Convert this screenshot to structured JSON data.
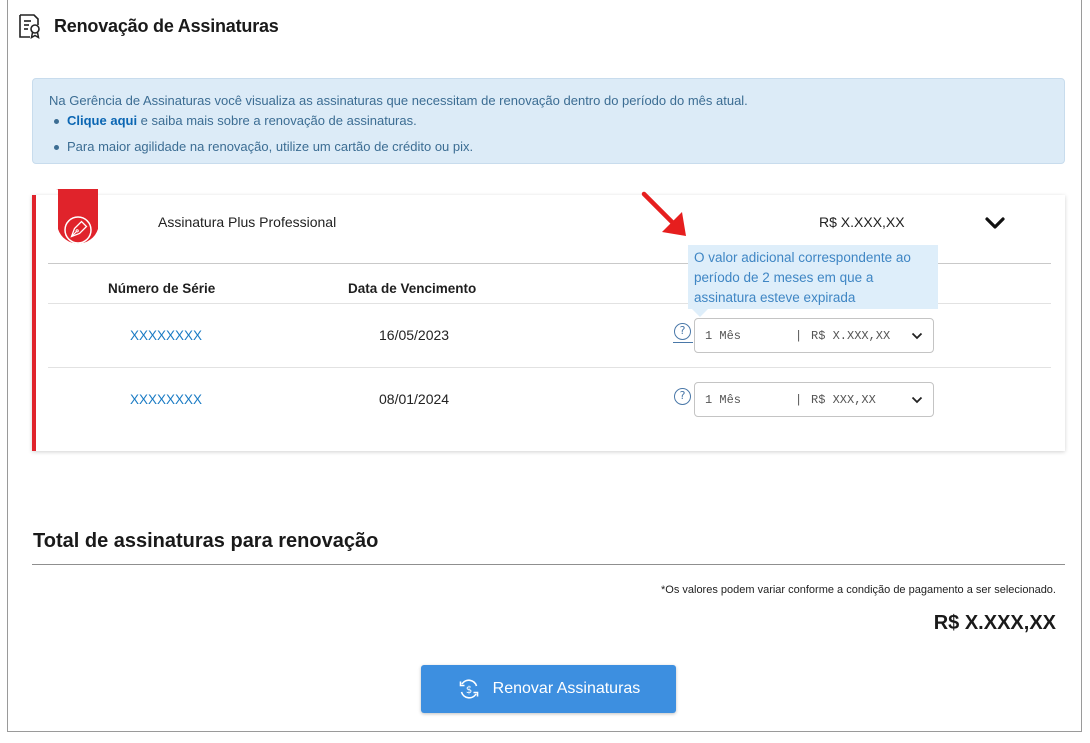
{
  "header": {
    "title": "Renovação de Assinaturas",
    "icon": "certificate-document-icon"
  },
  "info": {
    "intro": "Na Gerência de Assinaturas você visualiza as assinaturas que necessitam de renovação dentro do período do mês atual.",
    "bullets": [
      {
        "link": "Clique aqui",
        "text": " e saiba mais sobre a renovação de assinaturas."
      },
      {
        "text": "Para maior agilidade na renovação, utilize um cartão de crédito ou pix."
      }
    ]
  },
  "subscription": {
    "name": "Assinatura Plus Professional",
    "price": "R$ X.XXX,XX",
    "accent_color": "#e0232b",
    "columns": {
      "serial": "Número de Série",
      "due_date": "Data de Vencimento"
    },
    "rows": [
      {
        "serial": "XXXXXXXX",
        "due_date": "16/05/2023",
        "plan": "1 Mês",
        "separator": "|",
        "amount": "R$  X.XXX,XX"
      },
      {
        "serial": "XXXXXXXX",
        "due_date": "08/01/2024",
        "plan": "1 Mês",
        "separator": "|",
        "amount": "R$  XXX,XX"
      }
    ],
    "tooltip": "O valor adicional correspondente ao período de 2 meses em que a assinatura esteve expirada"
  },
  "total": {
    "title": "Total de assinaturas para renovação",
    "note": "*Os valores podem variar conforme a condição de pagamento a ser selecionado.",
    "value": "R$ X.XXX,XX"
  },
  "actions": {
    "renew_label": "Renovar Assinaturas",
    "button_color": "#3d8fe0"
  }
}
